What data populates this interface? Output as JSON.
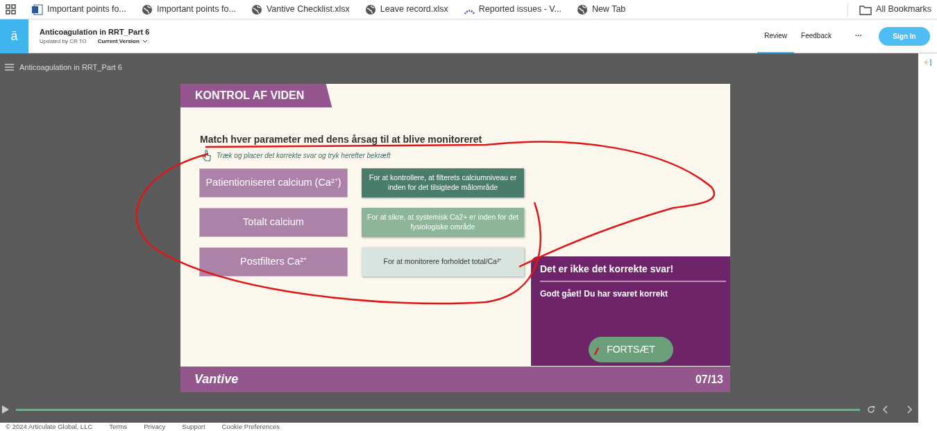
{
  "bookmarks": [
    {
      "kind": "apps"
    },
    {
      "kind": "word",
      "label": "Important points fo..."
    },
    {
      "kind": "globe",
      "label": "Important points fo..."
    },
    {
      "kind": "globe",
      "label": "Vantive Checklist.xlsx"
    },
    {
      "kind": "globe",
      "label": "Leave record.xlsx"
    },
    {
      "kind": "arc",
      "label": "Reported issues - V..."
    },
    {
      "kind": "globe",
      "label": "New Tab"
    }
  ],
  "all_bookmarks": "All Bookmarks",
  "app_header": {
    "logo": "ā",
    "title": "Anticoagulation in RRT_Part 6",
    "subtitle": "Updated by CR TO",
    "version": "Current Version",
    "nav": [
      {
        "label": "Review",
        "selected": true
      },
      {
        "label": "Feedback",
        "selected": false
      }
    ],
    "more": "···",
    "sign_in": "Sign In"
  },
  "player": {
    "title": "Anticoagulation in RRT_Part 6",
    "slide": {
      "header": "KONTROL AF VIDEN",
      "question": "Match hver parameter med dens årsag til at blive monitoreret",
      "hint": "Træk og placer det korrekte svar og tryk herefter bekræft",
      "pairs": [
        {
          "parameter": "Patientioniseret calcium (Ca²⁺)",
          "reason": "For at kontrollere, at filterets calciumniveau er inden for det tilsigtede målområde",
          "color": "#4a7c6b"
        },
        {
          "parameter": "Totalt calcium",
          "reason": "For at sikre, at systemisk Ca2+ er inden for det fysiologiske område",
          "color": "#8db597"
        },
        {
          "parameter": "Postfilters Ca²⁺",
          "reason": "For at monitorere forholdet total/Ca²⁺",
          "color": "#d7e5de"
        }
      ],
      "feedback": {
        "title": "Det er ikke det korrekte svar!",
        "message": "Godt gået! Du har svaret korrekt",
        "button": "FORTSÆT"
      },
      "brand": "Vantive",
      "page": "07/13"
    },
    "progress": {
      "level": 1.0
    }
  },
  "footer": [
    "© 2024 Articulate Global, LLC",
    "Terms",
    "Privacy",
    "Support",
    "Cookie Preferences"
  ]
}
